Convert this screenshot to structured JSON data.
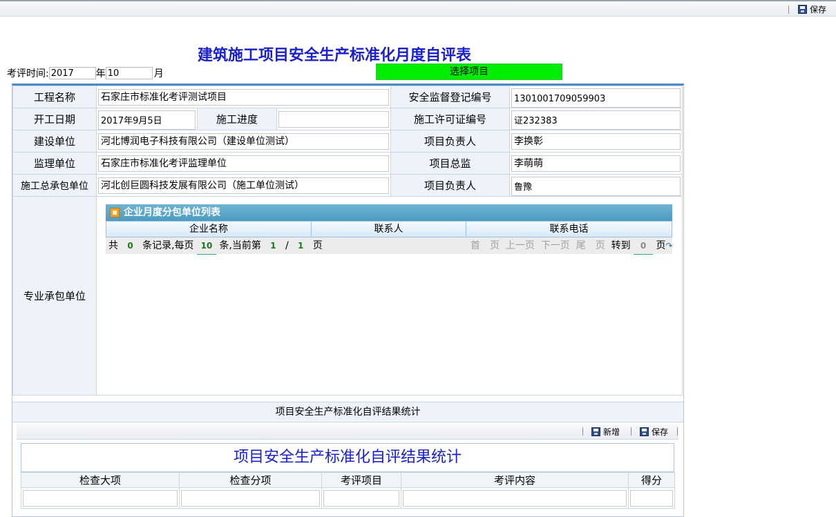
{
  "toolbar": {
    "save_label": "保存"
  },
  "title": "建筑施工项目安全生产标准化月度自评表",
  "period": {
    "label": "考评时间:",
    "year": "2017",
    "year_unit": "年",
    "month": "10",
    "month_unit": "月"
  },
  "select_project_label": "选择项目",
  "info": {
    "project_name_label": "工程名称",
    "project_name": "石家庄市标准化考评测试项目",
    "supervision_no_label": "安全监督登记编号",
    "supervision_no": "1301001709059903",
    "start_date_label": "开工日期",
    "start_date": "2017年9月5日",
    "progress_label": "施工进度",
    "progress": "",
    "permit_no_label": "施工许可证编号",
    "permit_no": "证232383",
    "builder_label": "建设单位",
    "builder": "河北博润电子科技有限公司（建设单位测试）",
    "manager_label": "项目负责人",
    "manager": "李换彰",
    "supervisor_label": "监理单位",
    "supervisor": "石家庄市标准化考评监理单位",
    "chief_label": "项目总监",
    "chief": "李萌萌",
    "contractor_label": "施工总承包单位",
    "contractor": "河北创巨圆科技发展有限公司（施工单位测试）",
    "manager2_label": "项目负责人",
    "manager2": "鲁豫",
    "sub_label": "专业承包单位"
  },
  "subgrid": {
    "title": "企业月度分包单位列表",
    "columns": [
      "企业名称",
      "联系人",
      "联系电话"
    ],
    "pager": {
      "total_prefix": "共",
      "total": "0",
      "records": "条记录,每页",
      "per_page": "10",
      "current_prefix": "条,当前第",
      "current": "1",
      "slash": "/",
      "pages": "1",
      "page_unit": "页",
      "first": "首　页",
      "prev": "上一页",
      "next": "下一页",
      "last": "尾　页",
      "goto": "转到",
      "goto_value": "0",
      "goto_unit": "页"
    }
  },
  "stats_bar": "项目安全生产标准化自评结果统计",
  "inner_toolbar": {
    "add_label": "新增",
    "save_label": "保存"
  },
  "result": {
    "title": "项目安全生产标准化自评结果统计",
    "columns": [
      "检查大项",
      "检查分项",
      "考评项目",
      "考评内容",
      "得分"
    ]
  },
  "colors": {
    "accent": "#1a20cc",
    "select_bg": "#00ee00",
    "grid_header": "#4a9cc3",
    "frame_border": "#4a8cc9"
  }
}
